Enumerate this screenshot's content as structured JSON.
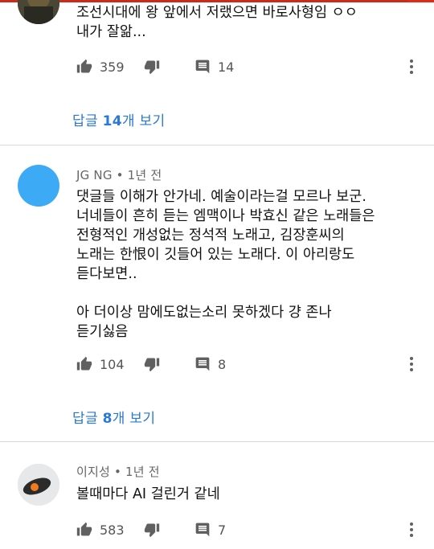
{
  "comments": [
    {
      "author": "",
      "time": "",
      "text": "조선시대에 왕 앞에서 저랬으면 바로사형임 ㅇㅇ\n내가 잘앎...",
      "likes": "359",
      "replies_count": "14",
      "replies_prefix": "답글 ",
      "replies_number": "14",
      "replies_suffix": "개 보기"
    },
    {
      "author": "JG NG",
      "time": "1년 전",
      "text": "댓글들 이해가 안가네. 예술이라는걸 모르나 보군.\n너네들이 흔히 듣는 엠맥이나 박효신 같은 노래들은\n전형적인 개성없는 정석적 노래고, 김장훈씨의\n노래는 한恨이 깃들어 있는 노래다. 이 아리랑도\n듣다보면..\n\n아 더이상 맘에도없는소리 못하겠다 걍 존나\n듣기싫음",
      "likes": "104",
      "replies_count": "8",
      "replies_prefix": "답글 ",
      "replies_number": "8",
      "replies_suffix": "개 보기"
    },
    {
      "author": "이지성",
      "time": "1년 전",
      "text": "볼때마다 AI 걸린거 같네",
      "likes": "583",
      "replies_count": "7"
    }
  ],
  "separator": "•",
  "icons": {
    "like": "thumbs-up-icon",
    "dislike": "thumbs-down-icon",
    "reply": "comment-icon",
    "more": "more-vertical-icon"
  },
  "colors": {
    "link": "#2a78d8",
    "avatar_blue": "#3daaf5",
    "top_strip": "#cc2a1a"
  }
}
